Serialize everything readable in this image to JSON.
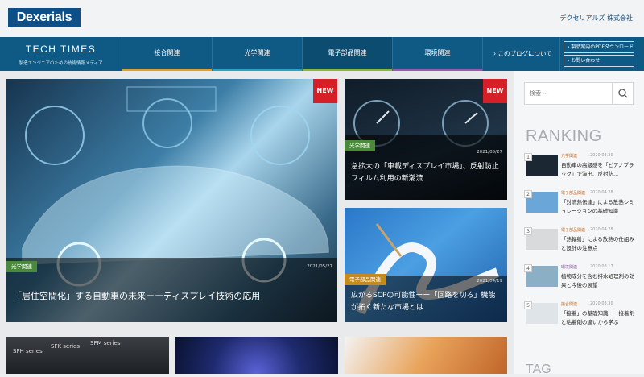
{
  "header": {
    "logo": "Dexerials",
    "company": "デクセリアルズ 株式会社"
  },
  "nav": {
    "brand_title": "TECH TIMES",
    "brand_sub": "製造エンジニアのための技術情報メディア",
    "items": [
      {
        "label": "接合関連",
        "color": "#e0a12b"
      },
      {
        "label": "光学関連",
        "color": "#2aa3c4"
      },
      {
        "label": "電子部品関連",
        "color": "#8bb83a"
      },
      {
        "label": "環境関連",
        "color": "#9a5aa8"
      }
    ],
    "about": "› このブログについて",
    "pdf": "› 製品案内のPDFダウンロード",
    "contact": "› お問い合わせ"
  },
  "cards": [
    {
      "badge": "NEW",
      "tag": "光学関連",
      "tag_color": "#4a8a3a",
      "date": "2021/05/27",
      "title": "「居住空間化」する自動車の未来ーーディスプレイ技術の応用"
    },
    {
      "badge": "NEW",
      "tag": "光学関連",
      "tag_color": "#4a8a3a",
      "date": "2021/05/27",
      "title": "急拡大の「車載ディスプレイ市場」、反射防止フィルム利用の新潮流"
    },
    {
      "tag": "電子部品関連",
      "tag_color": "#c58a1c",
      "date": "2021/04/19",
      "title": "広がるSCPの可能性ーー「回路を切る」機能が拓く新たな市場とは"
    }
  ],
  "bottom_cards": [
    {
      "labels": [
        "SFH series",
        "SFK series",
        "SFM series"
      ]
    }
  ],
  "sidebar": {
    "search_placeholder": "検索 ···",
    "ranking_title": "RANKING",
    "ranking": [
      {
        "num": "1",
        "cat": "光学関連",
        "date": "2020.03.30",
        "title": "自動車の高級感を「ピアノブラック」で演出、反射防...",
        "color": "#1b2733"
      },
      {
        "num": "2",
        "cat": "電子部品関連",
        "date": "2020.04.28",
        "title": "「対流熱伝達」による放熱シミュレーションの基礎知識",
        "color": "#6aa6d8"
      },
      {
        "num": "3",
        "cat": "電子部品関連",
        "date": "2020.04.28",
        "title": "「熱輻射」による放熱の仕組みと設計の注意点",
        "color": "#d9dadb"
      },
      {
        "num": "4",
        "cat": "環境関連",
        "date": "2020.08.17",
        "title": "植物成分を含む排水処理剤の効果と今後の展望",
        "color": "#8bb0c6"
      },
      {
        "num": "5",
        "cat": "接合関連",
        "date": "2020.03.30",
        "title": "「接着」の基礎知識ーー接着剤と粘着剤の違いから学ぶ",
        "color": "#dfe4e8"
      }
    ],
    "tag_title": "TAG"
  }
}
